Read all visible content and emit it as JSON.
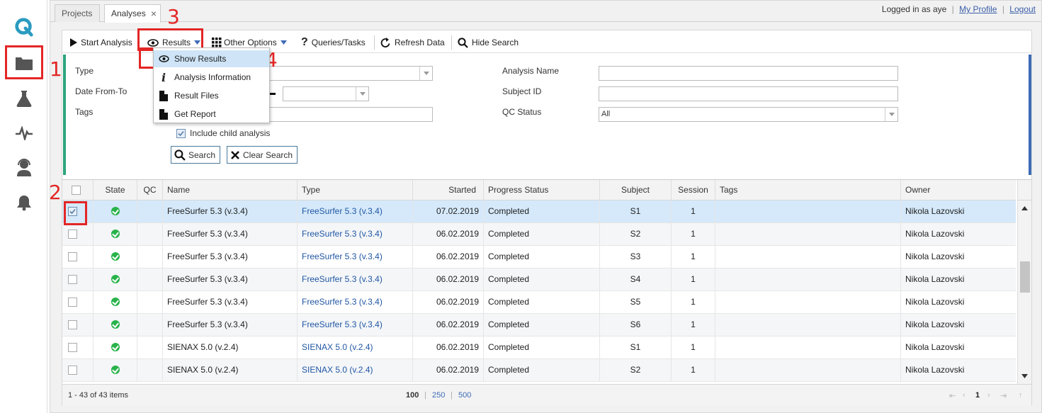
{
  "sidebar": {
    "logo": "Q",
    "items": [
      {
        "icon": "folder-icon",
        "active": true
      },
      {
        "icon": "flask-icon"
      },
      {
        "icon": "pulse-icon"
      },
      {
        "icon": "support-agent-icon"
      },
      {
        "icon": "bell-icon"
      }
    ]
  },
  "annotations": [
    "1",
    "2",
    "3",
    "4"
  ],
  "tabs": [
    {
      "label": "Projects"
    },
    {
      "label": "Analyses",
      "close": "×"
    }
  ],
  "user": {
    "logged_in_prefix": "Logged in as",
    "username": "aye",
    "separator": "|",
    "profile_link": "My Profile",
    "logout_link": "Logout"
  },
  "toolbar": {
    "start_analysis": "Start Analysis",
    "results": "Results",
    "other_options": "Other Options",
    "queries_tasks": "Queries/Tasks",
    "refresh_data": "Refresh Data",
    "hide_search": "Hide Search"
  },
  "results_menu": [
    {
      "label": "Show Results",
      "icon": "eye-icon"
    },
    {
      "label": "Analysis Information",
      "icon": "info-icon"
    },
    {
      "label": "Result Files",
      "icon": "file-icon"
    },
    {
      "label": "Get Report",
      "icon": "file-icon"
    }
  ],
  "search": {
    "type_label": "Type",
    "date_label": "Date From-To",
    "tags_label": "Tags",
    "include_child": "Include child analysis",
    "analysis_name_label": "Analysis Name",
    "subject_id_label": "Subject ID",
    "qc_status_label": "QC Status",
    "qc_status_value": "All",
    "search_btn": "Search",
    "clear_btn": "Clear Search"
  },
  "grid": {
    "headers": {
      "state": "State",
      "qc": "QC",
      "name": "Name",
      "type": "Type",
      "started": "Started",
      "progress": "Progress Status",
      "subject": "Subject",
      "session": "Session",
      "tags": "Tags",
      "owner": "Owner"
    },
    "rows": [
      {
        "name": "FreeSurfer 5.3 (v.3.4)",
        "type": "FreeSurfer 5.3 (v.3.4)",
        "started": "07.02.2019",
        "progress": "Completed",
        "subject": "S1",
        "session": "1",
        "owner": "Nikola Lazovski",
        "selected": true
      },
      {
        "name": "FreeSurfer 5.3 (v.3.4)",
        "type": "FreeSurfer 5.3 (v.3.4)",
        "started": "06.02.2019",
        "progress": "Completed",
        "subject": "S2",
        "session": "1",
        "owner": "Nikola Lazovski"
      },
      {
        "name": "FreeSurfer 5.3 (v.3.4)",
        "type": "FreeSurfer 5.3 (v.3.4)",
        "started": "06.02.2019",
        "progress": "Completed",
        "subject": "S3",
        "session": "1",
        "owner": "Nikola Lazovski"
      },
      {
        "name": "FreeSurfer 5.3 (v.3.4)",
        "type": "FreeSurfer 5.3 (v.3.4)",
        "started": "06.02.2019",
        "progress": "Completed",
        "subject": "S4",
        "session": "1",
        "owner": "Nikola Lazovski"
      },
      {
        "name": "FreeSurfer 5.3 (v.3.4)",
        "type": "FreeSurfer 5.3 (v.3.4)",
        "started": "06.02.2019",
        "progress": "Completed",
        "subject": "S5",
        "session": "1",
        "owner": "Nikola Lazovski"
      },
      {
        "name": "FreeSurfer 5.3 (v.3.4)",
        "type": "FreeSurfer 5.3 (v.3.4)",
        "started": "06.02.2019",
        "progress": "Completed",
        "subject": "S6",
        "session": "1",
        "owner": "Nikola Lazovski"
      },
      {
        "name": "SIENAX 5.0 (v.2.4)",
        "type": "SIENAX 5.0 (v.2.4)",
        "started": "06.02.2019",
        "progress": "Completed",
        "subject": "S1",
        "session": "1",
        "owner": "Nikola Lazovski"
      },
      {
        "name": "SIENAX 5.0 (v.2.4)",
        "type": "SIENAX 5.0 (v.2.4)",
        "started": "06.02.2019",
        "progress": "Completed",
        "subject": "S2",
        "session": "1",
        "owner": "Nikola Lazovski"
      }
    ]
  },
  "pager": {
    "items_info": "1 - 43 of 43 items",
    "page_sizes": [
      "100",
      "250",
      "500"
    ],
    "page_sep": "|",
    "current_page": "1"
  },
  "colors": {
    "accent_red": "#e32626",
    "link_blue": "#2157a4",
    "state_green": "#29b34a",
    "search_left_border": "#2da57e",
    "search_right_border": "#3d6bb6"
  }
}
